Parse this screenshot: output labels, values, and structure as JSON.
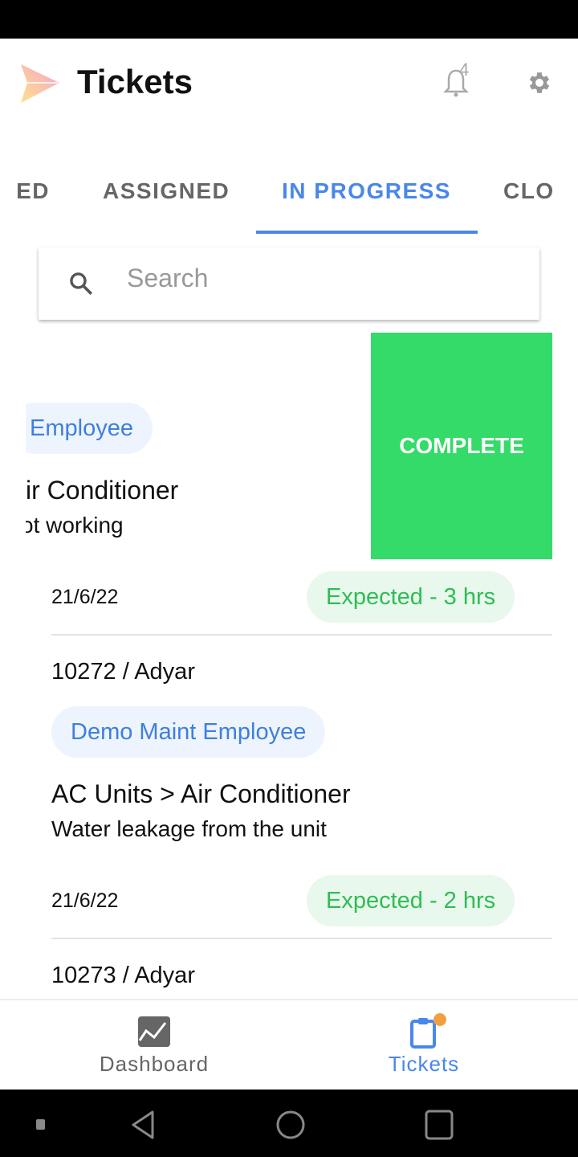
{
  "header": {
    "title": "Tickets",
    "notification_count": "4"
  },
  "tabs": [
    {
      "label": "ED"
    },
    {
      "label": "ASSIGNED"
    },
    {
      "label": "IN PROGRESS",
      "active": true
    },
    {
      "label": "CLO"
    }
  ],
  "search": {
    "placeholder": "Search",
    "value": ""
  },
  "swiped_ticket": {
    "assignee": "Employee",
    "title": "ir Conditioner",
    "description": "ot working",
    "date": "21/6/22",
    "expected": "Expected - 3 hrs",
    "action": "COMPLETE"
  },
  "tickets": [
    {
      "id_location": "10272 / Adyar",
      "assignee": "Demo Maint Employee",
      "title": "AC Units > Air Conditioner",
      "description": "Water leakage from the unit",
      "date": "21/6/22",
      "expected": "Expected - 2 hrs"
    },
    {
      "id_location": "10273 / Adyar"
    }
  ],
  "bottom_nav": [
    {
      "label": "Dashboard",
      "icon": "chart-icon"
    },
    {
      "label": "Tickets",
      "icon": "clipboard-icon",
      "active": true
    }
  ],
  "colors": {
    "accent": "#4a87ea",
    "complete": "#35db69",
    "expected": "#2fbd55",
    "badge": "#f0a040"
  }
}
